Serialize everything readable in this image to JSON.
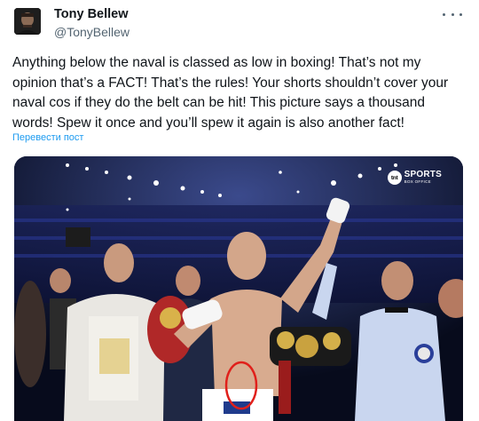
{
  "author": {
    "name": "Tony Bellew",
    "handle": "@TonyBellew"
  },
  "post": {
    "text": "Anything below the naval is classed as low in boxing! That’s not my opinion that’s a FACT! That’s the rules! Your shorts shouldn’t cover your naval cos if they do the belt can be hit! This picture says a thousand words! Spew it once and you’ll spew it again is also another fact!",
    "translate_label": "Перевести пост"
  },
  "media": {
    "watermark_mark": "tnt",
    "watermark_line1": "SPORTS",
    "watermark_line2": "BOX OFFICE"
  },
  "icons": {
    "more": "more-horizontal-icon",
    "avatar": "avatar"
  },
  "colors": {
    "accent": "#1d9bf0",
    "secondary_text": "#536471",
    "annotation": "#e0201b"
  }
}
